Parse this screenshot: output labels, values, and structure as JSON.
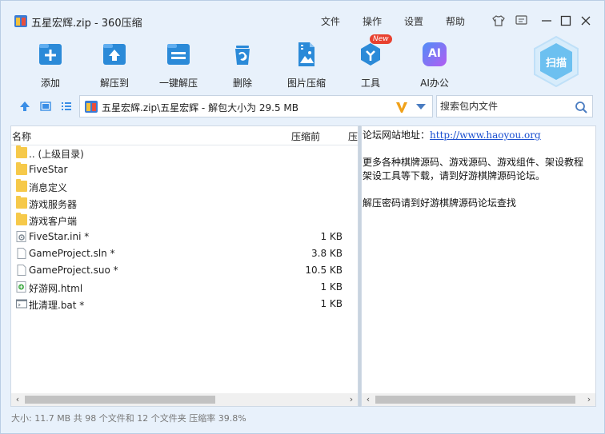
{
  "window": {
    "title": "五星宏辉.zip - 360压缩",
    "menu": [
      "文件",
      "操作",
      "设置",
      "帮助"
    ],
    "controls": [
      "shirt-icon",
      "feedback-icon",
      "minimize-icon",
      "maximize-icon",
      "close-icon"
    ]
  },
  "toolbar": {
    "tools": [
      {
        "label": "添加",
        "icon": "add-icon"
      },
      {
        "label": "解压到",
        "icon": "extract-to-icon"
      },
      {
        "label": "一键解压",
        "icon": "one-click-extract-icon"
      },
      {
        "label": "删除",
        "icon": "delete-icon"
      },
      {
        "label": "图片压缩",
        "icon": "image-compress-icon"
      },
      {
        "label": "工具",
        "icon": "tools-icon",
        "badge": "New"
      },
      {
        "label": "AI办公",
        "icon": "ai-office-icon",
        "icon_text": "AI"
      }
    ],
    "scan_label": "扫描",
    "accent": "#2b8ad8"
  },
  "address": {
    "path": "五星宏辉.zip\\五星宏辉 - 解包大小为 29.5 MB",
    "search_placeholder": "搜索包内文件"
  },
  "list": {
    "columns": {
      "name": "名称",
      "size_before": "压缩前",
      "size_after": "压"
    },
    "rows": [
      {
        "name": ".. (上级目录)",
        "size": "",
        "type": "folder"
      },
      {
        "name": "FiveStar",
        "size": "",
        "type": "folder"
      },
      {
        "name": "消息定义",
        "size": "",
        "type": "folder"
      },
      {
        "name": "游戏服务器",
        "size": "",
        "type": "folder"
      },
      {
        "name": "游戏客户端",
        "size": "",
        "type": "folder"
      },
      {
        "name": "FiveStar.ini *",
        "size": "1 KB",
        "type": "ini"
      },
      {
        "name": "GameProject.sln *",
        "size": "3.8 KB",
        "type": "file"
      },
      {
        "name": "GameProject.suo *",
        "size": "10.5 KB",
        "type": "file"
      },
      {
        "name": "好游网.html",
        "size": "1 KB",
        "type": "html"
      },
      {
        "name": "批清理.bat *",
        "size": "1 KB",
        "type": "bat"
      }
    ]
  },
  "preview": {
    "site_label": "论坛网站地址：",
    "site_url": "http://www.haoyou.org",
    "para1_line1": "更多各种棋牌源码、游戏源码、游戏组件、架设教程",
    "para1_line2": "架设工具等下载，请到好游棋牌源码论坛。",
    "para2": "解压密码请到好游棋牌源码论坛查找"
  },
  "status": {
    "text": "大小: 11.7 MB 共 98 个文件和 12 个文件夹 压缩率 39.8%"
  }
}
